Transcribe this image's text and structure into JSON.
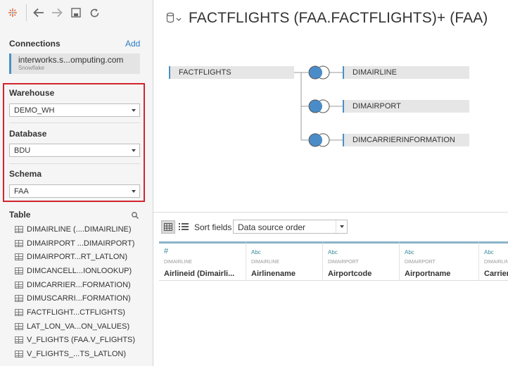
{
  "left_panel": {
    "connections_label": "Connections",
    "add_label": "Add",
    "connection": {
      "name": "interworks.s...omputing.com",
      "type": "Snowflake"
    },
    "warehouse": {
      "label": "Warehouse",
      "value": "DEMO_WH"
    },
    "database": {
      "label": "Database",
      "value": "BDU"
    },
    "schema": {
      "label": "Schema",
      "value": "FAA"
    },
    "table_label": "Table",
    "tables": [
      "DIMAIRLINE (....DIMAIRLINE)",
      "DIMAIRPORT ...DIMAIRPORT)",
      "DIMAIRPORT...RT_LATLON)",
      "DIMCANCELL...IONLOOKUP)",
      "DIMCARRIER...FORMATION)",
      "DIMUSCARRI...FORMATION)",
      "FACTFLIGHT...CTFLIGHTS)",
      "LAT_LON_VA...ON_VALUES)",
      "V_FLIGHTS (FAA.V_FLIGHTS)",
      "V_FLIGHTS_...TS_LATLON)"
    ]
  },
  "canvas": {
    "title": "FACTFLIGHTS (FAA.FACTFLIGHTS)+ (FAA)",
    "primary_table": "FACTFLIGHTS",
    "joined_tables": [
      "DIMAIRLINE",
      "DIMAIRPORT",
      "DIMCARRIERINFORMATION"
    ]
  },
  "grid": {
    "sort_label": "Sort fields",
    "sort_value": "Data source order",
    "columns": [
      {
        "type": "#",
        "table": "DIMAIRLINE",
        "name": "Airlineid (Dimairli..."
      },
      {
        "type": "Abc",
        "table": "DIMAIRLINE",
        "name": "Airlinename"
      },
      {
        "type": "Abc",
        "table": "DIMAIRPORT",
        "name": "Airportcode"
      },
      {
        "type": "Abc",
        "table": "DIMAIRPORT",
        "name": "Airportname"
      },
      {
        "type": "Abc",
        "table": "DIMAIRLINE",
        "name": "Carrier"
      }
    ]
  },
  "colors": {
    "accent": "#4a90c8",
    "join_fill": "#4a8cc8",
    "highlight": "#d0252e"
  }
}
